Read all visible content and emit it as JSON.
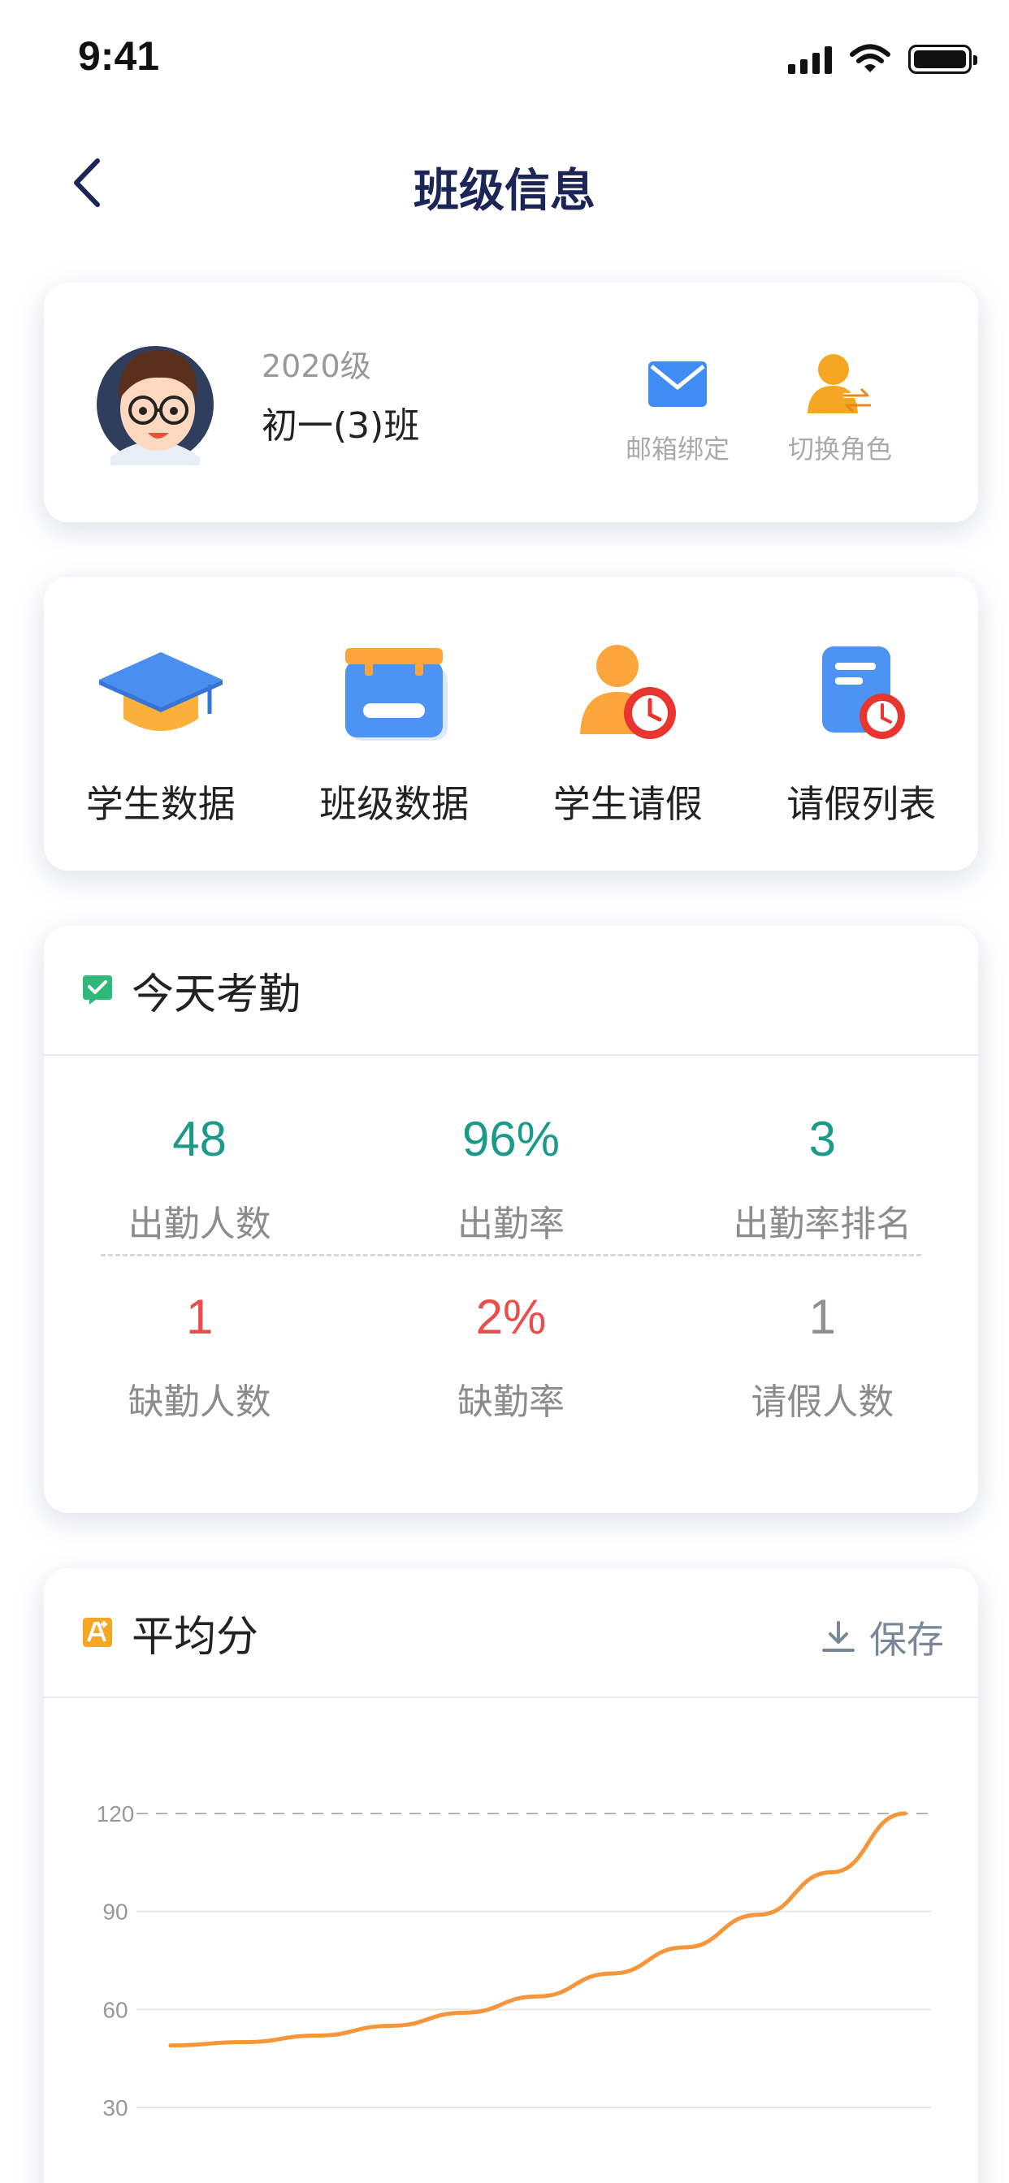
{
  "status_bar": {
    "time": "9:41"
  },
  "nav": {
    "title": "班级信息"
  },
  "profile": {
    "grade": "2020级",
    "class_name": "初一(3)班",
    "actions": [
      {
        "label": "邮箱绑定",
        "icon": "mail-icon"
      },
      {
        "label": "切换角色",
        "icon": "switch-role-icon"
      }
    ]
  },
  "features": [
    {
      "label": "学生数据",
      "icon": "graduation-cap-icon"
    },
    {
      "label": "班级数据",
      "icon": "class-board-icon"
    },
    {
      "label": "学生请假",
      "icon": "student-leave-icon"
    },
    {
      "label": "请假列表",
      "icon": "leave-list-icon"
    }
  ],
  "attendance": {
    "title": "今天考勤",
    "stats": [
      {
        "value": "48",
        "label": "出勤人数",
        "color": "#1a9a8a"
      },
      {
        "value": "96%",
        "label": "出勤率",
        "color": "#1a9a8a"
      },
      {
        "value": "3",
        "label": "出勤率排名",
        "color": "#1a9a8a"
      },
      {
        "value": "1",
        "label": "缺勤人数",
        "color": "#ea4d4b"
      },
      {
        "value": "2%",
        "label": "缺勤率",
        "color": "#ea4d4b"
      },
      {
        "value": "1",
        "label": "请假人数",
        "color": "#909090"
      }
    ]
  },
  "average": {
    "title": "平均分",
    "save_label": "保存"
  },
  "chart_data": {
    "type": "line",
    "title": "",
    "xlabel": "",
    "ylabel": "",
    "ylim": [
      0,
      120
    ],
    "y_ticks": [
      120,
      90,
      60,
      30
    ],
    "grid": true,
    "series": [
      {
        "color": "#f5963a",
        "x": [
          0,
          1,
          2,
          3,
          4,
          5,
          6,
          7,
          8,
          9,
          10
        ],
        "values": [
          49,
          50,
          52,
          55,
          59,
          64,
          71,
          79,
          89,
          102,
          120
        ]
      }
    ]
  }
}
